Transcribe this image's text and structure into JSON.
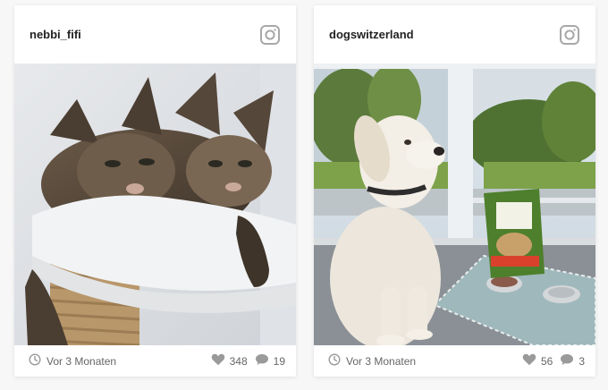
{
  "posts": [
    {
      "username": "nebbi_fifi",
      "time_ago": "Vor 3 Monaten",
      "likes": "348",
      "comments": "19",
      "image_subject": "two maine coon cats on cat tree"
    },
    {
      "username": "dogswitzerland",
      "time_ago": "Vor 3 Monaten",
      "likes": "56",
      "comments": "3",
      "image_subject": "white golden retriever by window with food bag"
    }
  ],
  "icons": {
    "platform": "instagram-icon",
    "time": "clock-icon",
    "likes": "heart-icon",
    "comments": "speech-bubble-icon"
  },
  "colors": {
    "icon_gray": "#9a9a9a",
    "text_gray": "#666666",
    "username": "#222222"
  }
}
